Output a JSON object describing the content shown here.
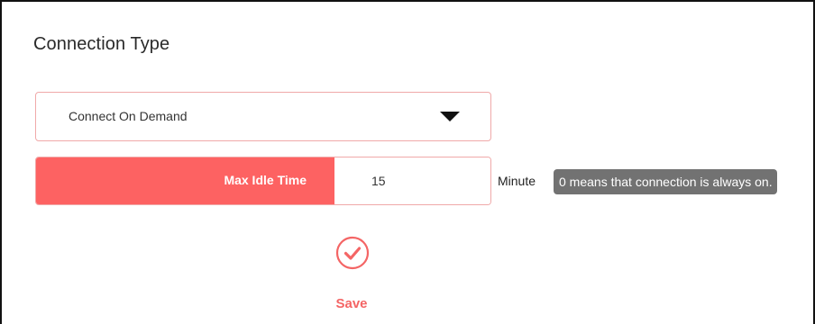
{
  "section": {
    "title": "Connection Type"
  },
  "connection_type_select": {
    "selected": "Connect On Demand"
  },
  "max_idle_time": {
    "label": "Max Idle Time",
    "value": "15",
    "unit": "Minute",
    "hint": "0 means that connection is always on."
  },
  "actions": {
    "save_label": "Save"
  },
  "colors": {
    "accent": "#fd6262",
    "border": "#f0a9a9",
    "hint_bg": "#727272"
  },
  "icons": {
    "dropdown": "caret-down-icon",
    "save": "check-circle-icon"
  }
}
